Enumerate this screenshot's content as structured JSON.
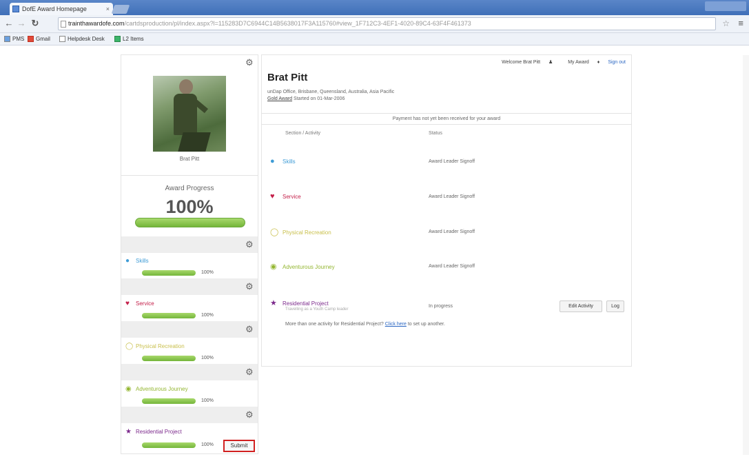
{
  "browser": {
    "tab_title": "DofE Award Homepage",
    "tab_close": "×",
    "url_host": "trainthawardofe.com",
    "url_path": "/cartdsproduction/pl/index.aspx?l=115283D7C6944C14B5638017F3A115760#view_1F712C3-4EF1-4020-89C4-63F4F461373",
    "bookmarks": [
      "PMS",
      "Gmail",
      "Helpdesk Desk",
      "L2 Items"
    ]
  },
  "sidebar": {
    "user_caption": "Brat Pitt",
    "progress_title": "Award Progress",
    "progress_value": "100%",
    "progress_fraction": 1.0,
    "submit_label": "Submit",
    "sections": [
      {
        "label": "Skills",
        "pct": "100%",
        "color": "#3f9cd6",
        "icon": "speech-bubble-icon"
      },
      {
        "label": "Service",
        "pct": "100%",
        "color": "#c4204a",
        "icon": "hands-icon"
      },
      {
        "label": "Physical Recreation",
        "pct": "100%",
        "color": "#c8bf4a",
        "icon": "runner-icon"
      },
      {
        "label": "Adventurous Journey",
        "pct": "100%",
        "color": "#93b630",
        "icon": "map-pin-icon"
      },
      {
        "label": "Residential Project",
        "pct": "100%",
        "color": "#7c2a8c",
        "icon": "figure-icon"
      }
    ]
  },
  "main": {
    "welcome": "Welcome Brat Pitt",
    "my_award": "My Award",
    "sign_out": "Sign out",
    "name": "Brat Pitt",
    "location": "unDap Office, Brisbane, Queensland, Australia, Asia Pacific",
    "start_link": "Gold Award",
    "start_text": "Started on 01-Mar-2006",
    "notice": "Payment has not yet been received for your award",
    "col_section": "Section / Activity",
    "col_status": "Status",
    "activities": [
      {
        "label": "Skills",
        "status": "Award Leader Signoff",
        "color": "#3f9cd6"
      },
      {
        "label": "Service",
        "status": "Award Leader Signoff",
        "color": "#c4204a"
      },
      {
        "label": "Physical Recreation",
        "status": "Award Leader Signoff",
        "color": "#c8bf4a"
      },
      {
        "label": "Adventurous Journey",
        "status": "Award Leader Signoff",
        "color": "#93b630"
      },
      {
        "label": "Residential Project",
        "sub": "Travelling as a Youth Camp leader",
        "status": "In progress",
        "color": "#7c2a8c"
      }
    ],
    "edit_activity": "Edit Activity",
    "log": "Log",
    "more_prefix": "More than one activity for Residential Project?",
    "more_link": "Click here",
    "more_suffix": "to set up another."
  }
}
